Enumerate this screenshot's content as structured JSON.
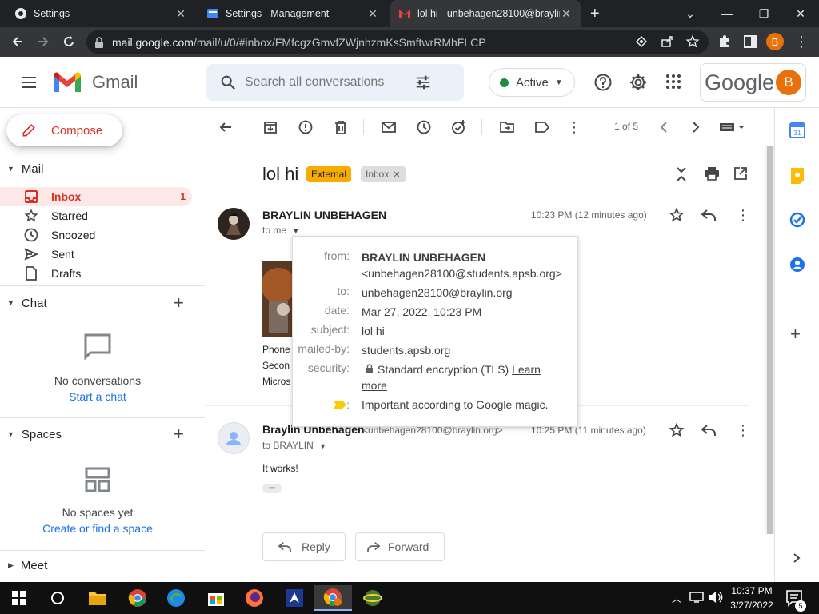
{
  "browser": {
    "tabs": [
      {
        "title": "Settings"
      },
      {
        "title": "Settings - Management"
      },
      {
        "title": "lol hi - unbehagen28100@braylin"
      }
    ],
    "new_tab": "+",
    "url_host": "mail.google.com",
    "url_path": "/mail/u/0/#inbox/FMfcgzGmvfZWjnhzmKsSmftwrRMhFLCP",
    "profile_initial": "B"
  },
  "gmail": {
    "logo_text": "Gmail",
    "search_placeholder": "Search all conversations",
    "status": "Active",
    "google_word": "Google",
    "account_initial": "B"
  },
  "nav": {
    "compose": "Compose",
    "mail_header": "Mail",
    "items": [
      {
        "label": "Inbox",
        "count": "1"
      },
      {
        "label": "Starred"
      },
      {
        "label": "Snoozed"
      },
      {
        "label": "Sent"
      },
      {
        "label": "Drafts"
      }
    ],
    "chat_header": "Chat",
    "chat_empty": "No conversations",
    "chat_link": "Start a chat",
    "spaces_header": "Spaces",
    "spaces_empty": "No spaces yet",
    "spaces_link": "Create or find a space",
    "meet_header": "Meet"
  },
  "toolbar": {
    "pager": "1 of 5"
  },
  "thread": {
    "subject": "lol hi",
    "labels": [
      "External",
      "Inbox"
    ],
    "messages": [
      {
        "sender": "BRAYLIN UNBEHAGEN",
        "to": "to me",
        "time": "10:23 PM (12 minutes ago)",
        "body_lines": [
          "Phone",
          "Secon",
          "Micros"
        ]
      },
      {
        "sender": "Braylin Unbehagen",
        "email": "<unbehagen28100@braylin.org>",
        "to": "to BRAYLIN",
        "time": "10:25 PM (11 minutes ago)",
        "body": "It works!",
        "ellipsis": "•••"
      }
    ]
  },
  "details": {
    "from_key": "from:",
    "from_name": "BRAYLIN UNBEHAGEN",
    "from_email": "<unbehagen28100@students.apsb.org>",
    "to_key": "to:",
    "to_val": "unbehagen28100@braylin.org",
    "date_key": "date:",
    "date_val": "Mar 27, 2022, 10:23 PM",
    "subject_key": "subject:",
    "subject_val": "lol hi",
    "mailedby_key": "mailed-by:",
    "mailedby_val": "students.apsb.org",
    "security_key": "security:",
    "security_val": "Standard encryption (TLS)",
    "security_link1": "Learn",
    "security_link2": "more",
    "important_key": ":",
    "important_val": "Important according to Google magic."
  },
  "actions": {
    "reply": "Reply",
    "forward": "Forward"
  },
  "taskbar": {
    "time": "10:37 PM",
    "date": "3/27/2022",
    "notif_count": "5"
  },
  "colors": {
    "gmail_red": "#d93025",
    "accent_blue": "#1a73e8",
    "external_chip": "#f9ab00",
    "inbox_chip": "#dddddd",
    "active_green": "#1e8e3e",
    "avatar_orange": "#e8710a"
  }
}
